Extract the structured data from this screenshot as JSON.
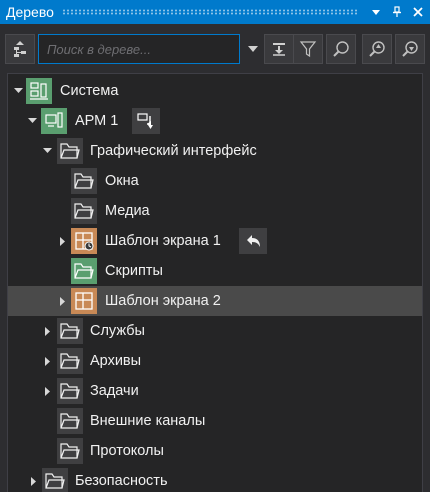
{
  "window": {
    "title": "Дерево"
  },
  "toolbar": {
    "search_placeholder": "Поиск в дереве..."
  },
  "tree": {
    "items": [
      {
        "label": "Система",
        "icon": "computer-system-icon",
        "expanded": true
      },
      {
        "label": "АРМ 1",
        "icon": "workstation-icon",
        "expanded": true
      },
      {
        "label": "Графический интерфейс",
        "icon": "folder-icon",
        "expanded": true
      },
      {
        "label": "Окна",
        "icon": "folder-icon"
      },
      {
        "label": "Медиа",
        "icon": "folder-icon"
      },
      {
        "label": "Шаблон экрана 1",
        "icon": "screen-template-icon",
        "expanded": false
      },
      {
        "label": "Скрипты",
        "icon": "folder-icon"
      },
      {
        "label": "Шаблон экрана 2",
        "icon": "screen-template-icon",
        "expanded": false,
        "selected": true
      },
      {
        "label": "Службы",
        "icon": "folder-icon",
        "expanded": false
      },
      {
        "label": "Архивы",
        "icon": "folder-icon",
        "expanded": false
      },
      {
        "label": "Задачи",
        "icon": "folder-icon",
        "expanded": false
      },
      {
        "label": "Внешние каналы",
        "icon": "folder-icon"
      },
      {
        "label": "Протоколы",
        "icon": "folder-icon"
      },
      {
        "label": "Безопасность",
        "icon": "folder-icon",
        "expanded": false
      }
    ]
  },
  "colors": {
    "titlebar": "#007acc",
    "panel": "#2d2d30",
    "tree_bg": "#252526",
    "selection": "#4a4a4a",
    "green_icon": "#5a9e6f",
    "orange_icon": "#c88956"
  }
}
